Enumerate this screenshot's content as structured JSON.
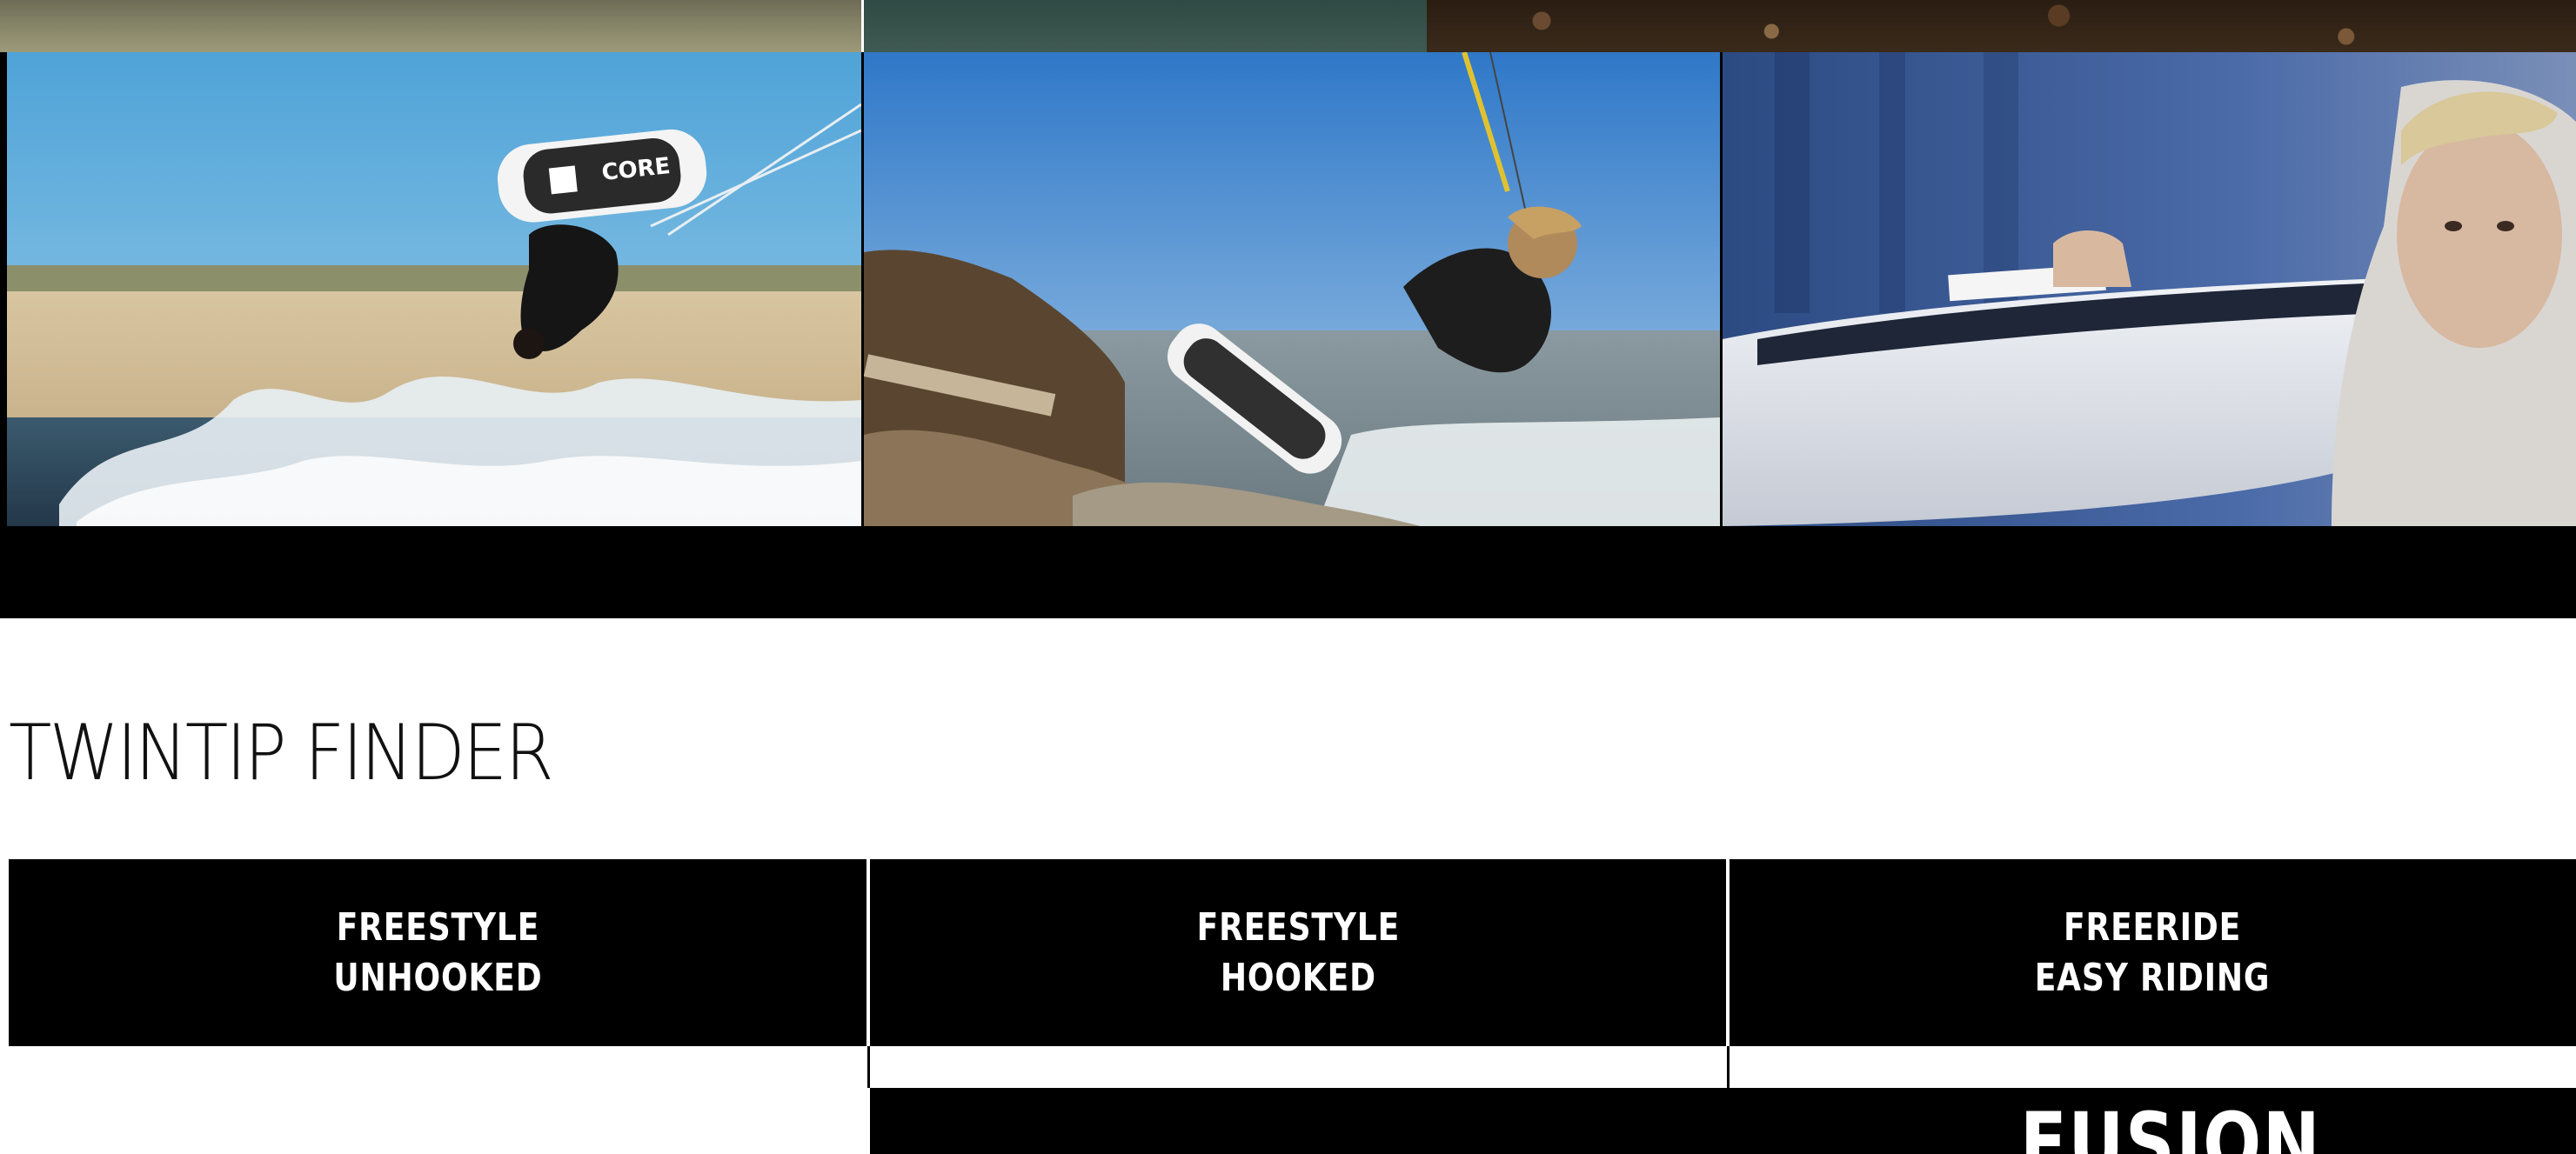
{
  "finder": {
    "title": "TWINTIP FINDER"
  },
  "categories": [
    {
      "line1": "FREESTYLE",
      "line2": "UNHOOKED"
    },
    {
      "line1": "FREESTYLE",
      "line2": "HOOKED"
    },
    {
      "line1": "FREERIDE",
      "line2": "EASY RIDING"
    }
  ],
  "product": {
    "name": "FUSION"
  },
  "board_print": {
    "brand": "CORE"
  },
  "colors": {
    "tab_background": "#000000",
    "tab_text": "#ffffff",
    "title_text": "#111111",
    "page_background": "#ffffff"
  }
}
